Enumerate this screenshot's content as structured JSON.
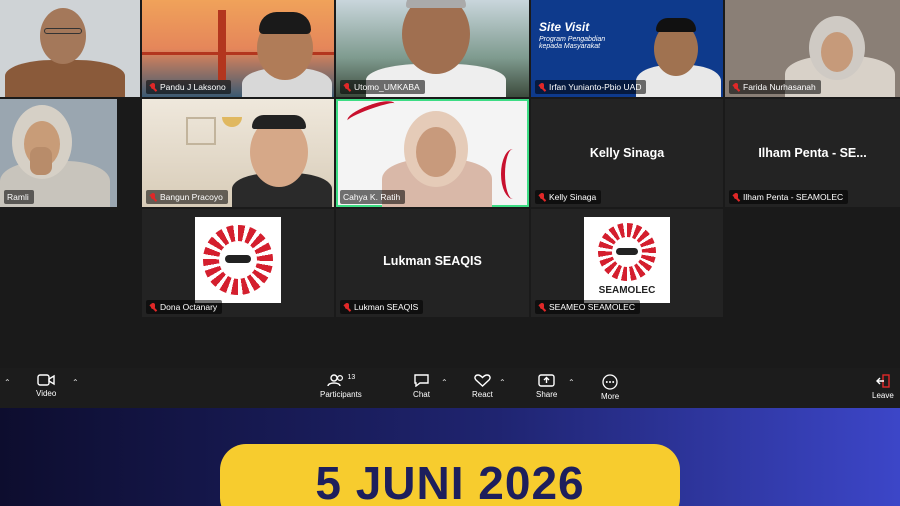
{
  "participants": [
    {
      "name": "",
      "key": "p1"
    },
    {
      "name": "Pandu J Laksono",
      "key": "p2"
    },
    {
      "name": "Utomo_UMKABA",
      "key": "p3"
    },
    {
      "name": "Irfan Yunianto-Pbio UAD",
      "key": "p4"
    },
    {
      "name": "Farida Nurhasanah",
      "key": "p5"
    },
    {
      "name": "Ramli",
      "key": "p6"
    },
    {
      "name": "Bangun Pracoyo",
      "key": "p7"
    },
    {
      "name": "Cahya K. Ratih",
      "key": "p8"
    },
    {
      "name": "Kelly Sinaga",
      "key": "p9",
      "display": "Kelly Sinaga"
    },
    {
      "name": "Ilham Penta - SEAMOLEC",
      "key": "p10",
      "display": "Ilham Penta - SE..."
    },
    {
      "name": "Dona Octanary",
      "key": "p11"
    },
    {
      "name": "Lukman SEAQIS",
      "key": "p12",
      "display": "Lukman SEAQIS"
    },
    {
      "name": "SEAMEO SEAMOLEC",
      "key": "p13"
    }
  ],
  "irfan_background": {
    "title": "Site Visit",
    "subtitle": "Program Pengabdian kepada Masyarakat"
  },
  "seamolec_logo_text": "SEAMOLEC",
  "toolbar": {
    "video": "Video",
    "participants": "Participants",
    "participants_count": "13",
    "chat": "Chat",
    "react": "React",
    "share": "Share",
    "more": "More",
    "leave": "Leave"
  },
  "banner": {
    "date": "5 JUNI 2026"
  },
  "colors": {
    "accent_green": "#3ddc84",
    "muted_red": "#e02828",
    "banner_yellow": "#f7cc2e",
    "banner_navy": "#1d1f5c"
  }
}
